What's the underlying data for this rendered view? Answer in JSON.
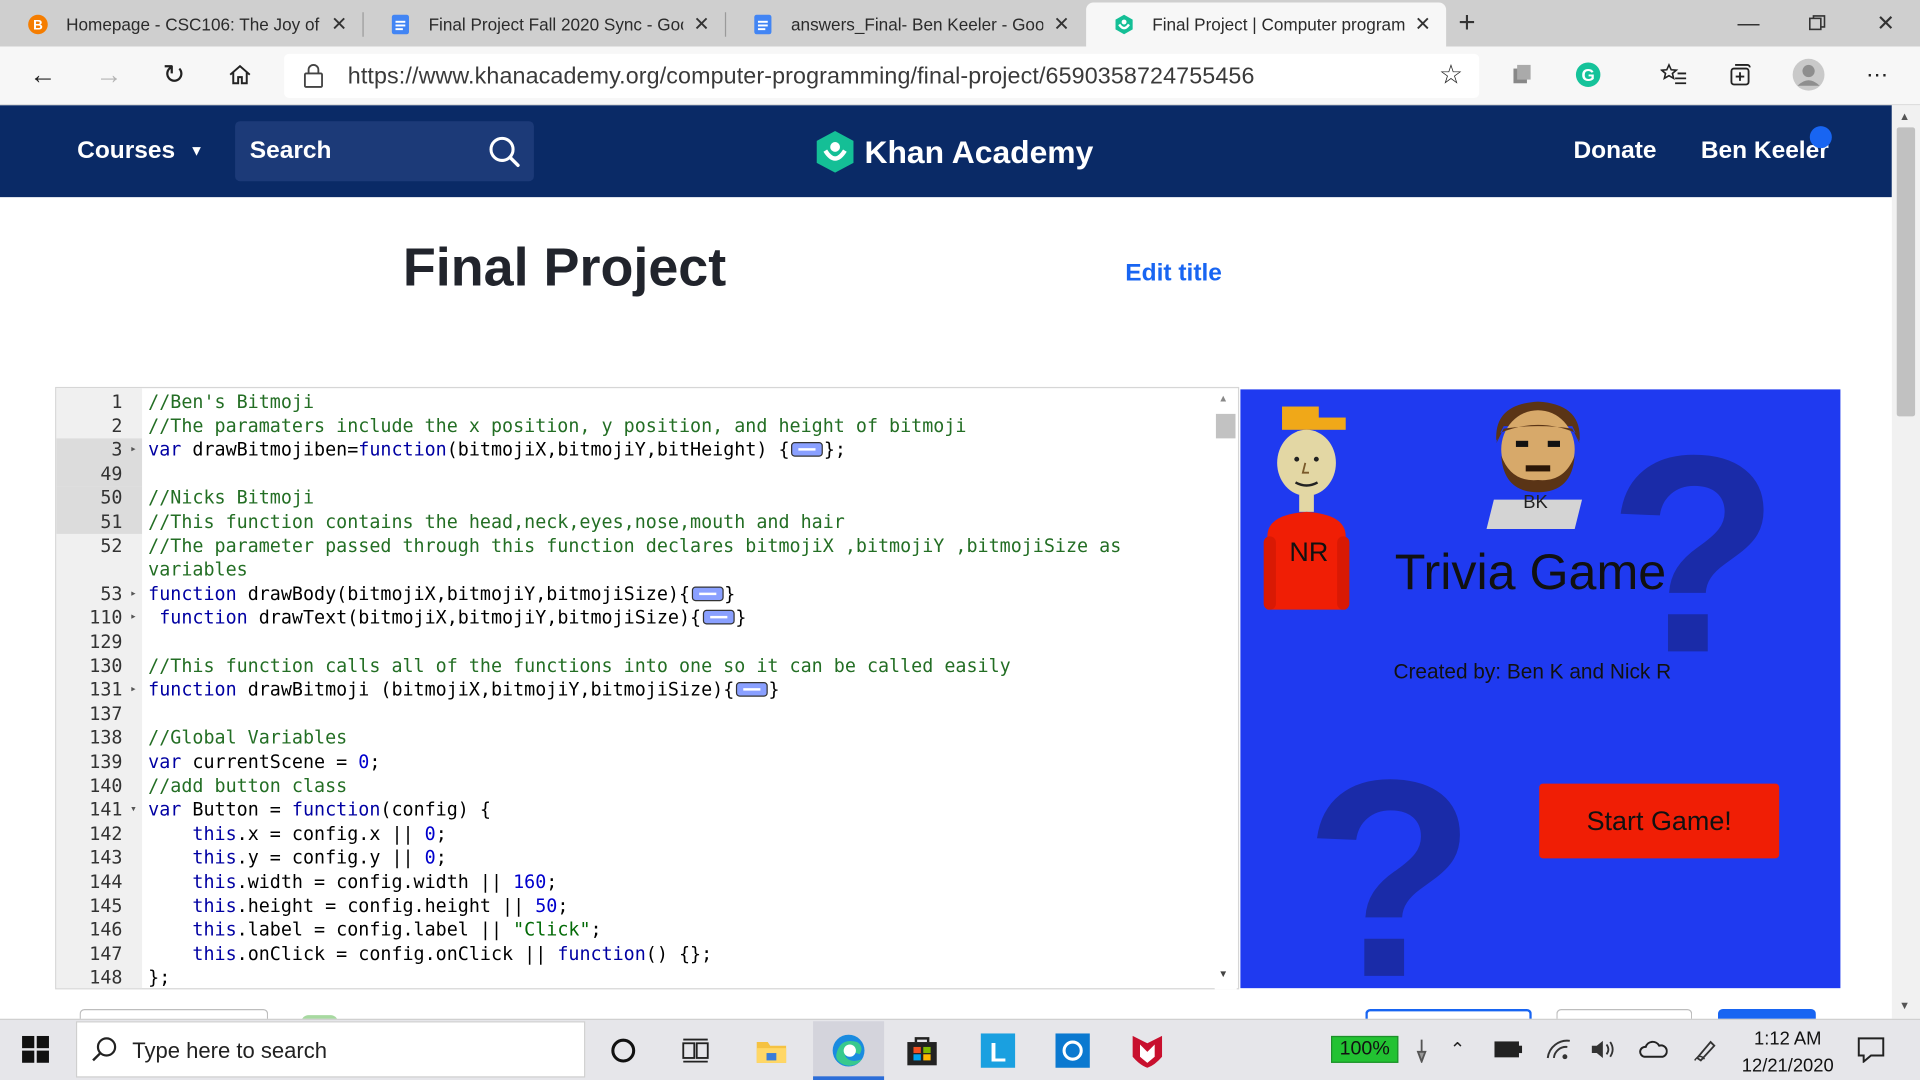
{
  "browser": {
    "tabs": [
      {
        "title": "Homepage - CSC106: The Joy of",
        "icon": "blogger-icon"
      },
      {
        "title": "Final Project Fall 2020 Sync - Goo",
        "icon": "google-docs-icon"
      },
      {
        "title": "answers_Final- Ben Keeler - Goo",
        "icon": "google-docs-icon"
      },
      {
        "title": "Final Project | Computer program",
        "icon": "khan-academy-icon"
      }
    ],
    "url": "https://www.khanacademy.org/computer-programming/final-project/6590358724755456"
  },
  "header": {
    "courses": "Courses",
    "search_placeholder": "Search",
    "logo": "Khan Academy",
    "donate": "Donate",
    "user": "Ben Keeler"
  },
  "page": {
    "title": "Final Project",
    "edit_title": "Edit title"
  },
  "editor": {
    "lines": [
      {
        "n": "1",
        "text": "//Ben's Bitmoji"
      },
      {
        "n": "2",
        "text": "//The paramaters include the x position, y position, and height of bitmoji"
      },
      {
        "n": "3",
        "text": "var drawBitmojiben=function(bitmojiX,bitmojiY,bitHeight) {…};"
      },
      {
        "n": "49",
        "text": ""
      },
      {
        "n": "50",
        "text": "//Nicks Bitmoji"
      },
      {
        "n": "51",
        "text": "//This function contains the head,neck,eyes,nose,mouth and hair"
      },
      {
        "n": "52",
        "text": "//The parameter passed through this function declares bitmojiX ,bitmojiY ,bitmojiSize as variables"
      },
      {
        "n": "53",
        "text": "function drawBody(bitmojiX,bitmojiY,bitmojiSize){…}"
      },
      {
        "n": "110",
        "text": " function drawText(bitmojiX,bitmojiY,bitmojiSize){…}"
      },
      {
        "n": "129",
        "text": ""
      },
      {
        "n": "130",
        "text": "//This function calls all of the functions into one so it can be called easily"
      },
      {
        "n": "131",
        "text": "function drawBitmoji (bitmojiX,bitmojiY,bitmojiSize){…}"
      },
      {
        "n": "137",
        "text": ""
      },
      {
        "n": "138",
        "text": "//Global Variables"
      },
      {
        "n": "139",
        "text": "var currentScene = 0;"
      },
      {
        "n": "140",
        "text": "//add button class"
      },
      {
        "n": "141",
        "text": "var Button = function(config) {"
      },
      {
        "n": "142",
        "text": "    this.x = config.x || 0;"
      },
      {
        "n": "143",
        "text": "    this.y = config.y || 0;"
      },
      {
        "n": "144",
        "text": "    this.width = config.width || 160;"
      },
      {
        "n": "145",
        "text": "    this.height = config.height || 50;"
      },
      {
        "n": "146",
        "text": "    this.label = config.label || \"Click\";"
      },
      {
        "n": "147",
        "text": "    this.onClick = config.onClick || function() {};"
      },
      {
        "n": "148",
        "text": "};"
      }
    ]
  },
  "canvas": {
    "badge_nr": "NR",
    "badge_bk": "BK",
    "title": "Trivia Game",
    "credits": "Created by: Ben K and Nick R",
    "start_button": "Start Game!",
    "colors": {
      "background": "#1f3af0",
      "question_mark": "#1a2ba8",
      "button": "#f01e05"
    }
  },
  "taskbar": {
    "search_placeholder": "Type here to search",
    "battery": "100%",
    "time": "1:12 AM",
    "date": "12/21/2020"
  }
}
